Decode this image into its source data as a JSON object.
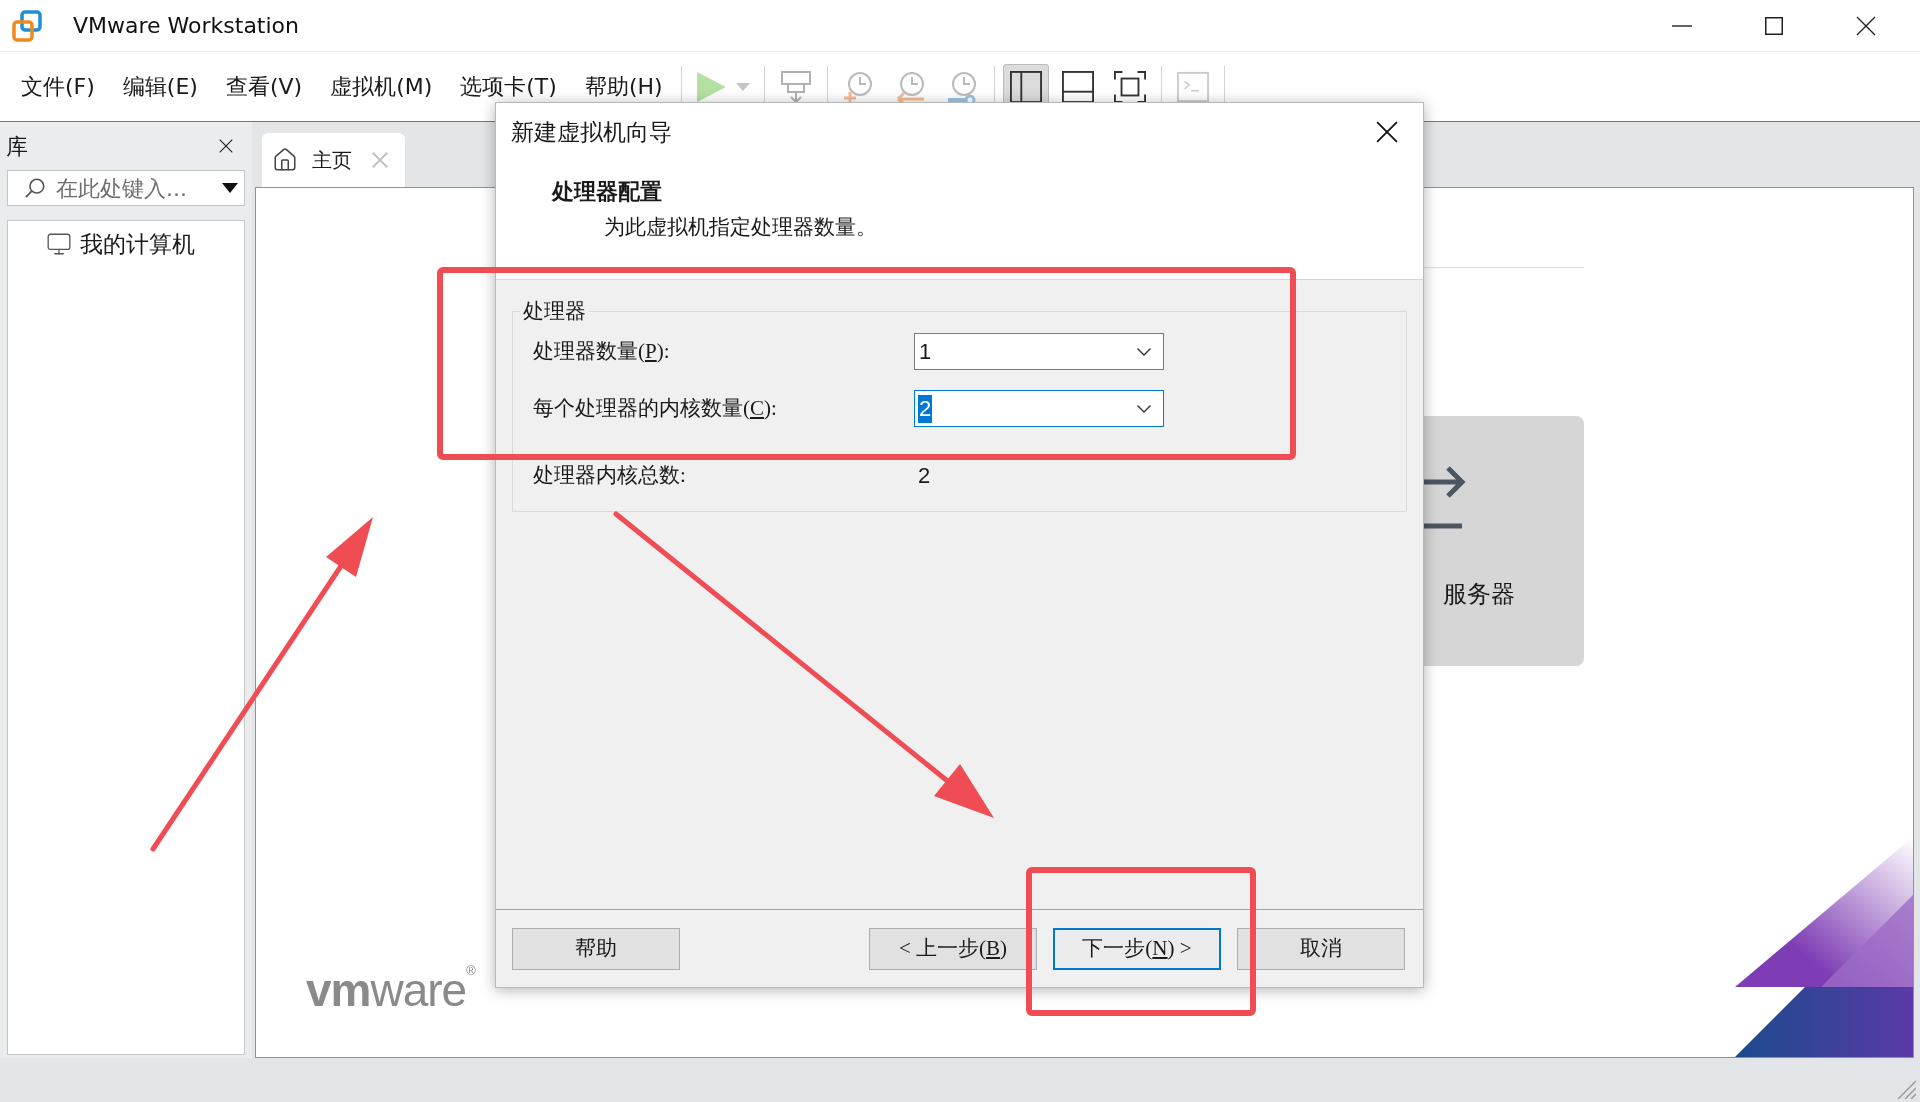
{
  "window": {
    "title": "VMware Workstation"
  },
  "menu": [
    "文件(F)",
    "编辑(E)",
    "查看(V)",
    "虚拟机(M)",
    "选项卡(T)",
    "帮助(H)"
  ],
  "toolbar": {
    "actions_disabled": true,
    "view_modes": [
      {
        "selected": true
      },
      {
        "selected": false
      },
      {
        "selected": false
      }
    ]
  },
  "library": {
    "title": "库",
    "search": {
      "placeholder": "在此处键入..."
    },
    "items": [
      {
        "label": "我的计算机",
        "selected": false
      }
    ]
  },
  "tabs": [
    {
      "label": "主页",
      "selected": true
    }
  ],
  "home": {
    "card_label": "服务器",
    "logo": "**vm**ware$^{®}$"
  },
  "dialog": {
    "title": "新建虚拟机向导",
    "heading": "处理器配置",
    "subheading": "为此虚拟机指定处理器数量。",
    "group": {
      "title": "处理器",
      "fields": [
        {
          "kind": "dropdown",
          "label": {
            "before": "处理器数量(",
            "key": "P",
            "after": "):"
          },
          "value": "1",
          "focused": false
        },
        {
          "kind": "dropdown",
          "label": {
            "before": "每个处理器的内核数量(",
            "key": "C",
            "after": "):"
          },
          "value": "2",
          "focused": true
        },
        {
          "kind": "readout",
          "label": {
            "before": "处理器内核总数:"
          },
          "value": "2"
        }
      ]
    },
    "buttons_left": [
      {
        "label": {
          "before": "帮助"
        },
        "default": false
      }
    ],
    "buttons_right": [
      {
        "label": {
          "before": "< 上一步(",
          "key": "B",
          "after": ")"
        },
        "default": false
      },
      {
        "label": {
          "before": "下一步(",
          "key": "N",
          "after": ") >"
        },
        "default": true
      },
      {
        "label": {
          "before": "取消"
        },
        "default": false
      }
    ]
  }
}
